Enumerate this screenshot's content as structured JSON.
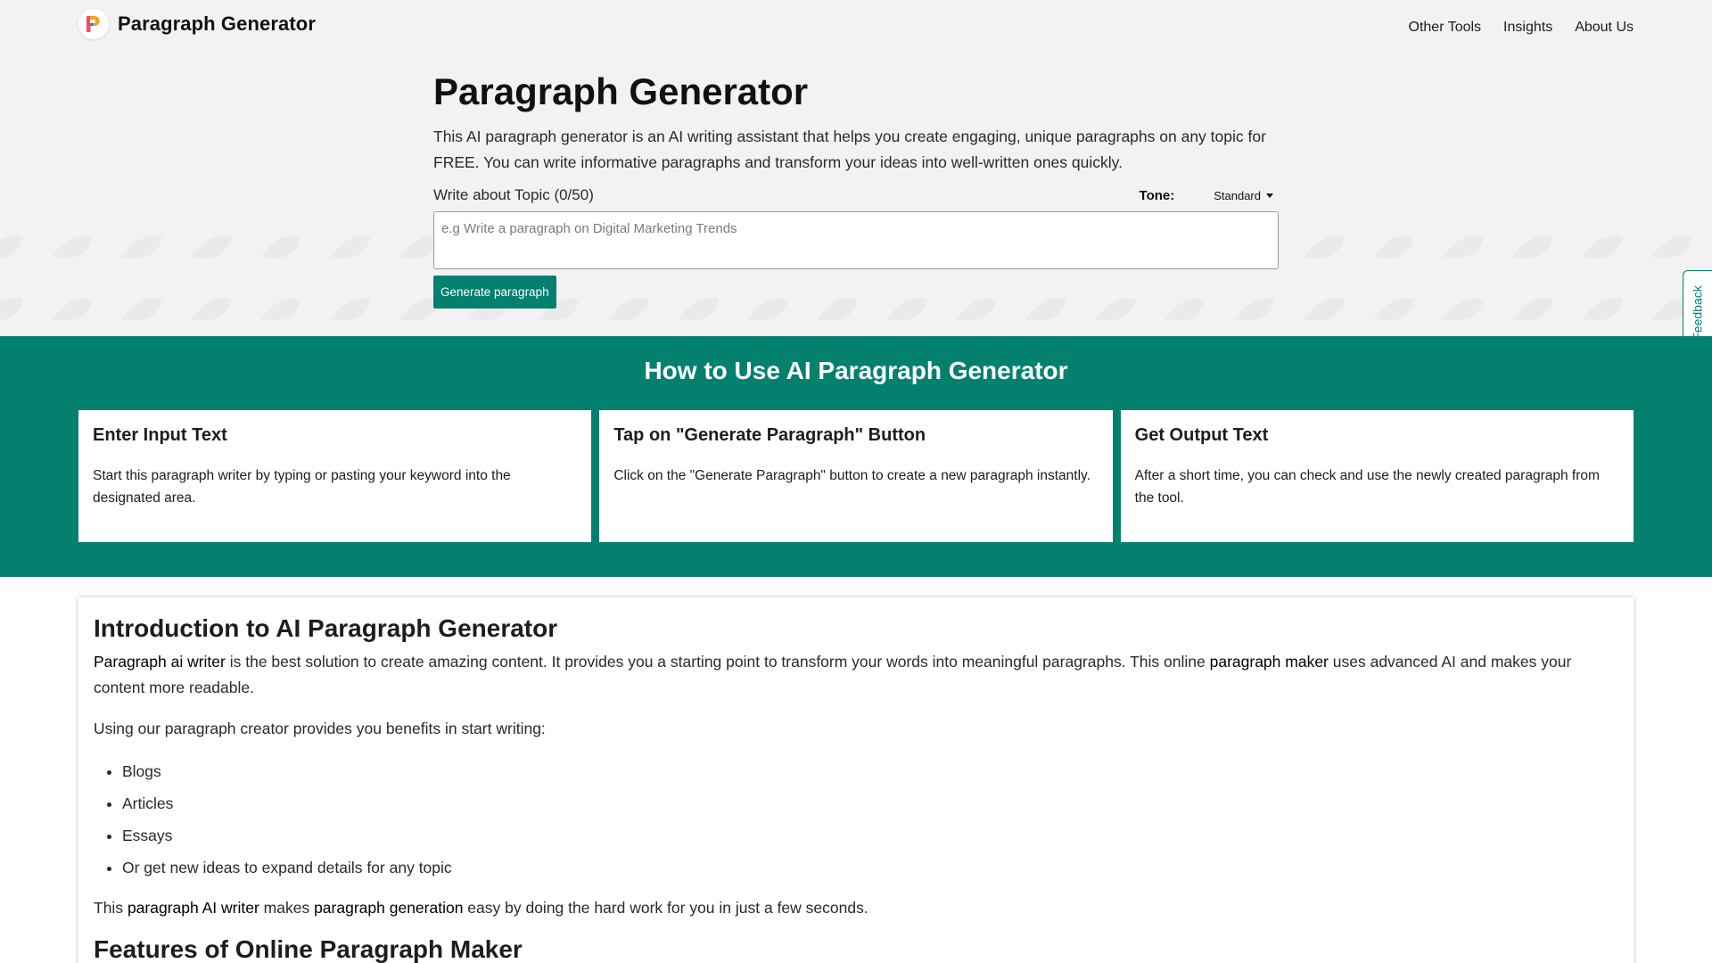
{
  "header": {
    "brand_name": "Paragraph Generator",
    "logo_letter": "P",
    "nav": [
      "Other Tools",
      "Insights",
      "About Us"
    ]
  },
  "tool": {
    "title": "Paragraph Generator",
    "description": "This AI paragraph generator is an AI writing assistant that helps you create engaging, unique paragraphs on any topic for FREE. You can write informative paragraphs and transform your ideas into well-written ones quickly.",
    "field_label": "Write about Topic (0/50)",
    "tone_label": "Tone:",
    "tone_value": "Standard",
    "input_placeholder": "e.g Write a paragraph on Digital Marketing Trends",
    "input_value": "",
    "generate_label": "Generate paragraph"
  },
  "feedback_label": "Feedback",
  "howto": {
    "title": "How to Use AI Paragraph Generator",
    "steps": [
      {
        "title": "Enter Input Text",
        "text": "Start this paragraph writer by typing or pasting your keyword into the designated area."
      },
      {
        "title": "Tap on \"Generate Paragraph\" Button",
        "text": "Click on the \"Generate Paragraph\" button to create a new paragraph instantly."
      },
      {
        "title": "Get Output Text",
        "text": "After a short time, you can check and use the newly created paragraph from the tool."
      }
    ]
  },
  "intro": {
    "title": "Introduction to AI Paragraph Generator",
    "p1": {
      "link1": "Paragraph ai writer",
      "text1": " is the best solution to create amazing content. It provides you a starting point to transform your words into meaningful paragraphs. This online ",
      "link2": "paragraph maker",
      "text2": " uses advanced AI and makes your content more readable."
    },
    "p2": "Using our paragraph creator provides you benefits in start writing:",
    "list": [
      "Blogs",
      "Articles",
      "Essays",
      "Or get new ideas to expand details for any topic"
    ],
    "p3": {
      "text1": "This ",
      "link1": "paragraph AI writer",
      "text2": " makes ",
      "link2": "paragraph generation",
      "text3": " easy by doing the hard work for you in just a few seconds."
    },
    "next_title": "Features of Online Paragraph Maker"
  },
  "colors": {
    "accent": "#04806f",
    "hero_bg": "#f2f2f2"
  },
  "icons": {
    "logo": "p-letter-logo-icon",
    "tone_caret": "caret-down-icon"
  }
}
